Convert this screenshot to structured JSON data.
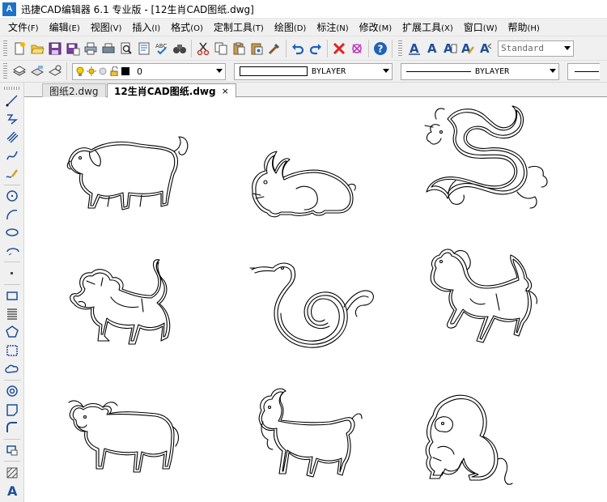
{
  "window": {
    "title": "迅捷CAD编辑器 6.1 专业版  - [12生肖CAD图纸.dwg]",
    "logo_text": "A"
  },
  "menu": [
    {
      "label": "文件",
      "acc": "(F)"
    },
    {
      "label": "编辑",
      "acc": "(E)"
    },
    {
      "label": "视图",
      "acc": "(V)"
    },
    {
      "label": "插入",
      "acc": "(I)"
    },
    {
      "label": "格式",
      "acc": "(O)"
    },
    {
      "label": "定制工具",
      "acc": "(T)"
    },
    {
      "label": "绘图",
      "acc": "(D)"
    },
    {
      "label": "标注",
      "acc": "(N)"
    },
    {
      "label": "修改",
      "acc": "(M)"
    },
    {
      "label": "扩展工具",
      "acc": "(X)"
    },
    {
      "label": "窗口",
      "acc": "(W)"
    },
    {
      "label": "帮助",
      "acc": "(H)"
    }
  ],
  "toolbar": {
    "text_style": "Standard",
    "layer": "0",
    "color": "BYLAYER",
    "linetype": "BYLAYER"
  },
  "tabs": [
    {
      "label": "图纸2.dwg",
      "active": false
    },
    {
      "label": "12生肖CAD图纸.dwg",
      "active": true,
      "close": "×"
    }
  ],
  "colors": {
    "accent": "#1e73c8",
    "delete_red": "#e02020",
    "undo_blue": "#1f5fbf"
  },
  "drawing": {
    "animals": [
      "pig",
      "rabbit",
      "dragon",
      "tiger",
      "snake",
      "horse",
      "ox",
      "goat",
      "monkey"
    ]
  }
}
